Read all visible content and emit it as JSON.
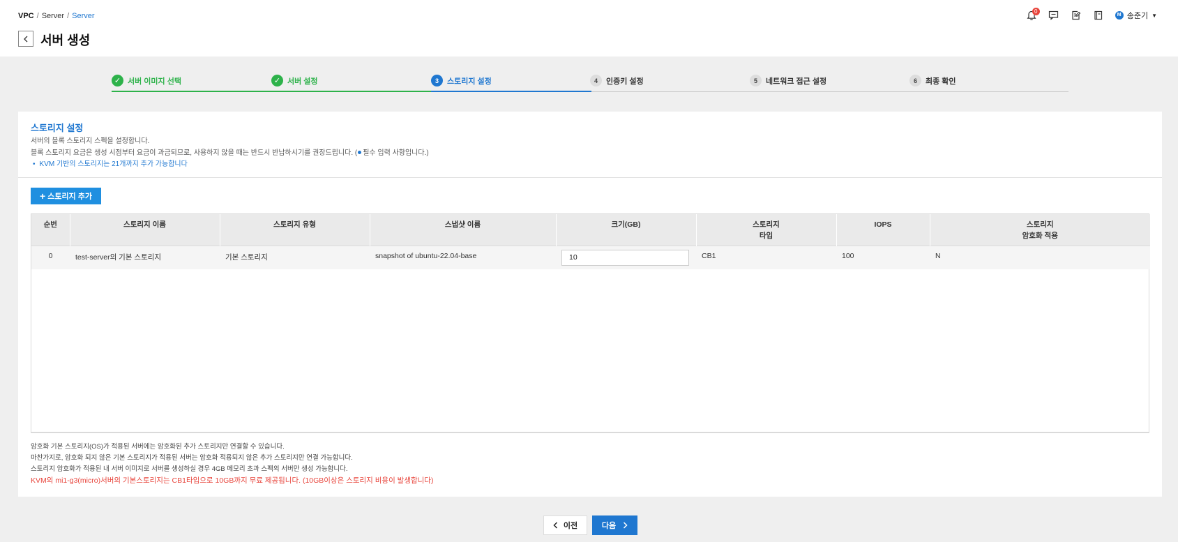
{
  "breadcrumb": {
    "items": [
      "VPC",
      "Server",
      "Server"
    ],
    "separator": "/"
  },
  "page": {
    "title": "서버 생성"
  },
  "header_util": {
    "notification_count": "0",
    "user_initial": "M",
    "user_name": "송준기"
  },
  "stepper": {
    "steps": [
      {
        "num": "✓",
        "label": "서버 이미지 선택",
        "state": "done"
      },
      {
        "num": "✓",
        "label": "서버 설정",
        "state": "done"
      },
      {
        "num": "3",
        "label": "스토리지 설정",
        "state": "current"
      },
      {
        "num": "4",
        "label": "인증키 설정",
        "state": "todo"
      },
      {
        "num": "5",
        "label": "네트워크 접근 설정",
        "state": "todo"
      },
      {
        "num": "6",
        "label": "최종 확인",
        "state": "todo"
      }
    ]
  },
  "storage": {
    "section_title": "스토리지 설정",
    "desc_1": "서버의 블록 스토리지 스펙을 설정합니다.",
    "desc_2_before": "블록 스토리지 요금은 생성 시점부터 요금이 과금되므로, 사용하지 않을 때는 반드시 반납하시기를 권장드립니다. (",
    "desc_2_after": "필수 입력 사항입니다.)",
    "note": "KVM 기반의 스토리지는 21개까지 추가 가능합니다",
    "add_button": "스토리지 추가",
    "table": {
      "headers": [
        "순번",
        "스토리지 이름",
        "스토리지 유형",
        "스냅샷 이름",
        "크기(GB)",
        "스토리지\n타입",
        "IOPS",
        "스토리지\n암호화 적용"
      ],
      "rows": [
        {
          "index": "0",
          "name": "test-server의 기본 스토리지",
          "type": "기본 스토리지",
          "snapshot": "snapshot of ubuntu-22.04-base",
          "size": "10",
          "storage_type": "CB1",
          "iops": "100",
          "encryption": "N"
        }
      ]
    },
    "footnotes": [
      "암호화 기본 스토리지(OS)가 적용된 서버에는 암호화된 추가 스토리지만 연결할 수 있습니다.",
      "마찬가지로, 암호화 되지 않은 기본 스토리지가 적용된 서버는 암호화 적용되지 않은 추가 스토리지만 연결 가능합니다.",
      "스토리지 암호화가 적용된 내 서버 이미지로 서버를 생성하실 경우 4GB 메모리 초과 스펙의 서버만 생성 가능합니다."
    ],
    "warning": "KVM의 mi1-g3(micro)서버의 기본스토리지는 CB1타입으로 10GB까지 무료 제공됩니다. (10GB이상은 스토리지 비용이 발생합니다)"
  },
  "nav": {
    "prev_label": "이전",
    "next_label": "다음"
  },
  "colors": {
    "accent": "#1f77d0",
    "done": "#2db24a",
    "warning": "#e8453c"
  }
}
